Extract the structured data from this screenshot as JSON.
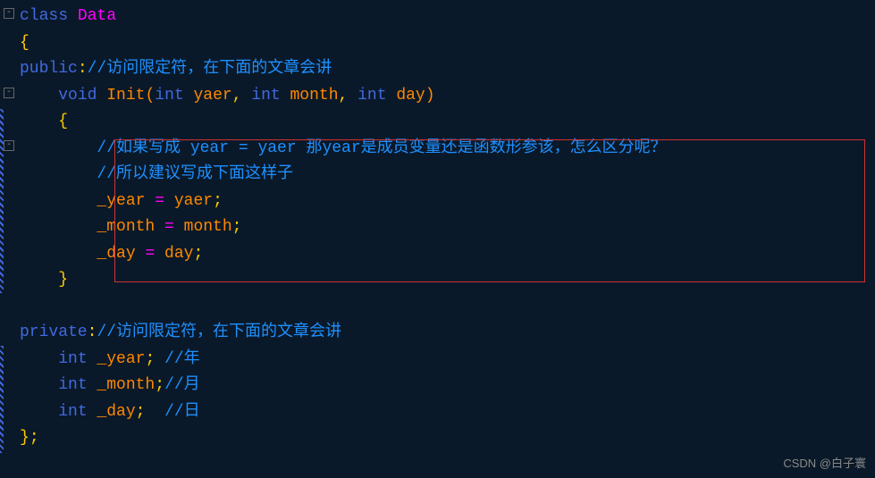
{
  "code": {
    "line1": {
      "kw": "class",
      "name": " Data"
    },
    "line2": {
      "brace": "{"
    },
    "line3": {
      "access": "public",
      "colon": ":",
      "comment": "//访问限定符，在下面的文章会讲"
    },
    "line4": {
      "indent": "    ",
      "void": "void",
      "func": " Init",
      "lparen": "(",
      "int1": "int",
      "p1": " yaer",
      "c1": ", ",
      "int2": "int",
      "p2": " month",
      "c2": ", ",
      "int3": "int",
      "p3": " day",
      "rparen": ")"
    },
    "line5": {
      "indent": "    ",
      "brace": "{"
    },
    "line6": {
      "indent": "        ",
      "comment": "//如果写成 year = yaer 那year是成员变量还是函数形参该，怎么区分呢？"
    },
    "line7": {
      "indent": "        ",
      "comment": "//所以建议写成下面这样子"
    },
    "line8": {
      "indent": "        ",
      "var": "_year",
      "op": " = ",
      "val": "yaer",
      "semi": ";"
    },
    "line9": {
      "indent": "        ",
      "var": "_month",
      "op": " = ",
      "val": "month",
      "semi": ";"
    },
    "line10": {
      "indent": "        ",
      "var": "_day",
      "op": " = ",
      "val": "day",
      "semi": ";"
    },
    "line11": {
      "indent": "    ",
      "brace": "}"
    },
    "line12": {
      "blank": " "
    },
    "line13": {
      "access": "private",
      "colon": ":",
      "comment": "//访问限定符，在下面的文章会讲"
    },
    "line14": {
      "indent": "    ",
      "int": "int",
      "var": " _year",
      "semi": ";",
      "space": " ",
      "comment": "//年"
    },
    "line15": {
      "indent": "    ",
      "int": "int",
      "var": " _month",
      "semi": ";",
      "comment": "//月"
    },
    "line16": {
      "indent": "    ",
      "int": "int",
      "var": " _day",
      "semi": ";",
      "space": "  ",
      "comment": "//日"
    },
    "line17": {
      "brace": "}",
      "semi": ";"
    }
  },
  "fold": {
    "minus": "-"
  },
  "watermark": "CSDN @白子寰"
}
